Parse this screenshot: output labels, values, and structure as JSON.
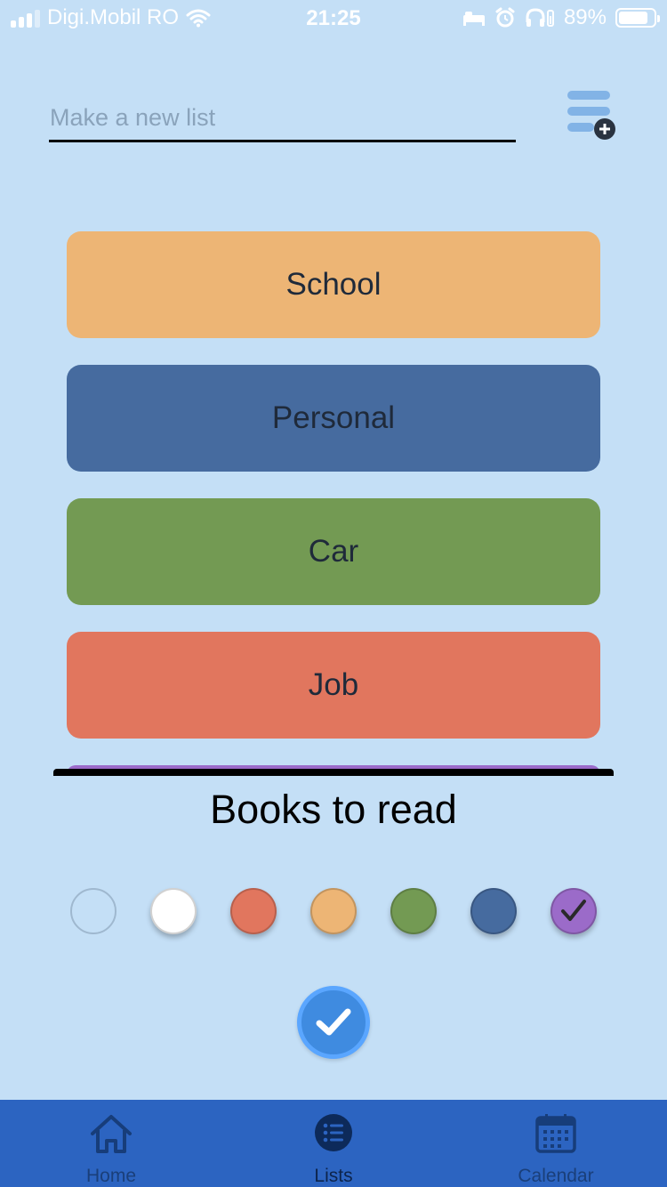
{
  "status_bar": {
    "carrier": "Digi.Mobil RO",
    "time": "21:25",
    "battery": "89%"
  },
  "new_list": {
    "placeholder": "Make a new list",
    "value": ""
  },
  "lists": [
    {
      "label": "School",
      "color": "#edb575"
    },
    {
      "label": "Personal",
      "color": "#466b9f"
    },
    {
      "label": "Car",
      "color": "#739a53"
    },
    {
      "label": "Job",
      "color": "#e1765e"
    }
  ],
  "editor": {
    "title": "Books to read",
    "colors": [
      {
        "name": "light-blue",
        "color": "#c4dff6",
        "selected": false
      },
      {
        "name": "white",
        "color": "#ffffff",
        "selected": false
      },
      {
        "name": "red",
        "color": "#e1765e",
        "selected": false
      },
      {
        "name": "orange",
        "color": "#edb575",
        "selected": false
      },
      {
        "name": "green",
        "color": "#739a53",
        "selected": false
      },
      {
        "name": "blue",
        "color": "#466b9f",
        "selected": false
      },
      {
        "name": "purple",
        "color": "#9b6bc9",
        "selected": true
      }
    ],
    "partial_card_color": "#9b6bc9"
  },
  "tab_bar": {
    "tabs": [
      {
        "label": "Home",
        "icon": "home-icon",
        "active": false
      },
      {
        "label": "Lists",
        "icon": "list-icon",
        "active": true
      },
      {
        "label": "Calendar",
        "icon": "calendar-icon",
        "active": false
      }
    ]
  },
  "accent_colors": {
    "background": "#c4dff6",
    "tab_bar": "#2c64c1",
    "confirm": "#3f8be0"
  }
}
